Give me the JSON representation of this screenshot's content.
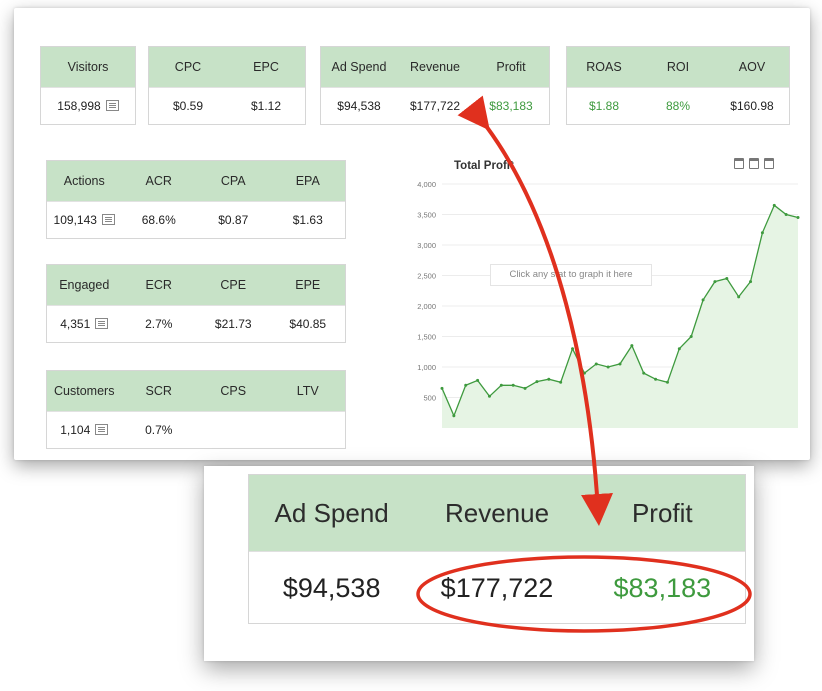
{
  "stats_top": {
    "visitors": {
      "header": [
        "Visitors"
      ],
      "values": [
        "158,998"
      ]
    },
    "cpc_epc": {
      "header": [
        "CPC",
        "EPC"
      ],
      "values": [
        "$0.59",
        "$1.12"
      ]
    },
    "spend": {
      "header": [
        "Ad Spend",
        "Revenue",
        "Profit"
      ],
      "values": [
        "$94,538",
        "$177,722",
        "$83,183"
      ]
    },
    "ratios": {
      "header": [
        "ROAS",
        "ROI",
        "AOV"
      ],
      "values": [
        "$1.88",
        "88%",
        "$160.98"
      ]
    }
  },
  "stats_left": {
    "actions": {
      "header": [
        "Actions",
        "ACR",
        "CPA",
        "EPA"
      ],
      "values": [
        "109,143",
        "68.6%",
        "$0.87",
        "$1.63"
      ]
    },
    "engaged": {
      "header": [
        "Engaged",
        "ECR",
        "CPE",
        "EPE"
      ],
      "values": [
        "4,351",
        "2.7%",
        "$21.73",
        "$40.85"
      ]
    },
    "customers": {
      "header": [
        "Customers",
        "SCR",
        "CPS",
        "LTV"
      ],
      "values": [
        "1,104",
        "0.7%"
      ]
    }
  },
  "chart": {
    "title": "Total Profit",
    "hint": "Click any stat to graph it here",
    "icons": [
      "calendar-icon",
      "calendar-icon",
      "calendar-icon"
    ],
    "colors": {
      "line": "#3e9a3e",
      "fill": "#e6f4e4",
      "accent": "#e0301e"
    }
  },
  "chart_data": {
    "type": "area",
    "title": "Total Profit",
    "xlabel": "",
    "ylabel": "",
    "ylim": [
      0,
      4000
    ],
    "yticks": [
      500,
      1000,
      1500,
      2000,
      2500,
      3000,
      3500,
      4000
    ],
    "grid": true,
    "legend": "none",
    "series": [
      {
        "values": [
          650,
          200,
          700,
          780,
          520,
          700,
          700,
          650,
          760,
          800,
          750,
          1300,
          900,
          1050,
          1000,
          1050,
          1350,
          900,
          800,
          750,
          1300,
          1500,
          2100,
          2400,
          2450,
          2150,
          2400,
          3200,
          3650,
          3500,
          3450
        ]
      }
    ]
  },
  "zoom": {
    "header": [
      "Ad Spend",
      "Revenue",
      "Profit"
    ],
    "values": [
      "$94,538",
      "$177,722",
      "$83,183"
    ]
  }
}
